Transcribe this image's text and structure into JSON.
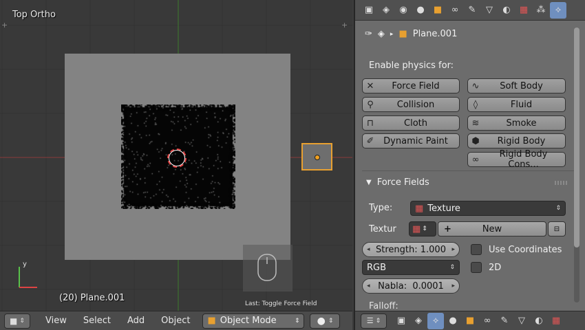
{
  "viewport": {
    "view_name": "Top Ortho",
    "object_status": "(20) Plane.001",
    "last_operator": "Last: Toggle Force Field"
  },
  "header": {
    "menus": [
      "View",
      "Select",
      "Add",
      "Object"
    ],
    "mode": "Object Mode"
  },
  "properties": {
    "object_name": "Plane.001",
    "enable_physics_label": "Enable physics for:",
    "physics_buttons": {
      "force_field": "Force Field",
      "soft_body": "Soft Body",
      "collision": "Collision",
      "fluid": "Fluid",
      "cloth": "Cloth",
      "smoke": "Smoke",
      "dynamic_paint": "Dynamic Paint",
      "rigid_body": "Rigid Body",
      "rigid_body_constraint": "Rigid Body Cons..."
    },
    "force_fields": {
      "panel_title": "Force Fields",
      "type_label": "Type:",
      "type_value": "Texture",
      "texture_label": "Textur",
      "new_label": "New",
      "strength": "Strength: 1.000",
      "use_coordinates": "Use Coordinates",
      "color_mode": "RGB",
      "two_d": "2D",
      "nabla": "Nabla:  0.0001",
      "falloff": "Falloff:"
    }
  },
  "colors": {
    "accent": "#6f8fbf",
    "selection": "#e8a030"
  }
}
